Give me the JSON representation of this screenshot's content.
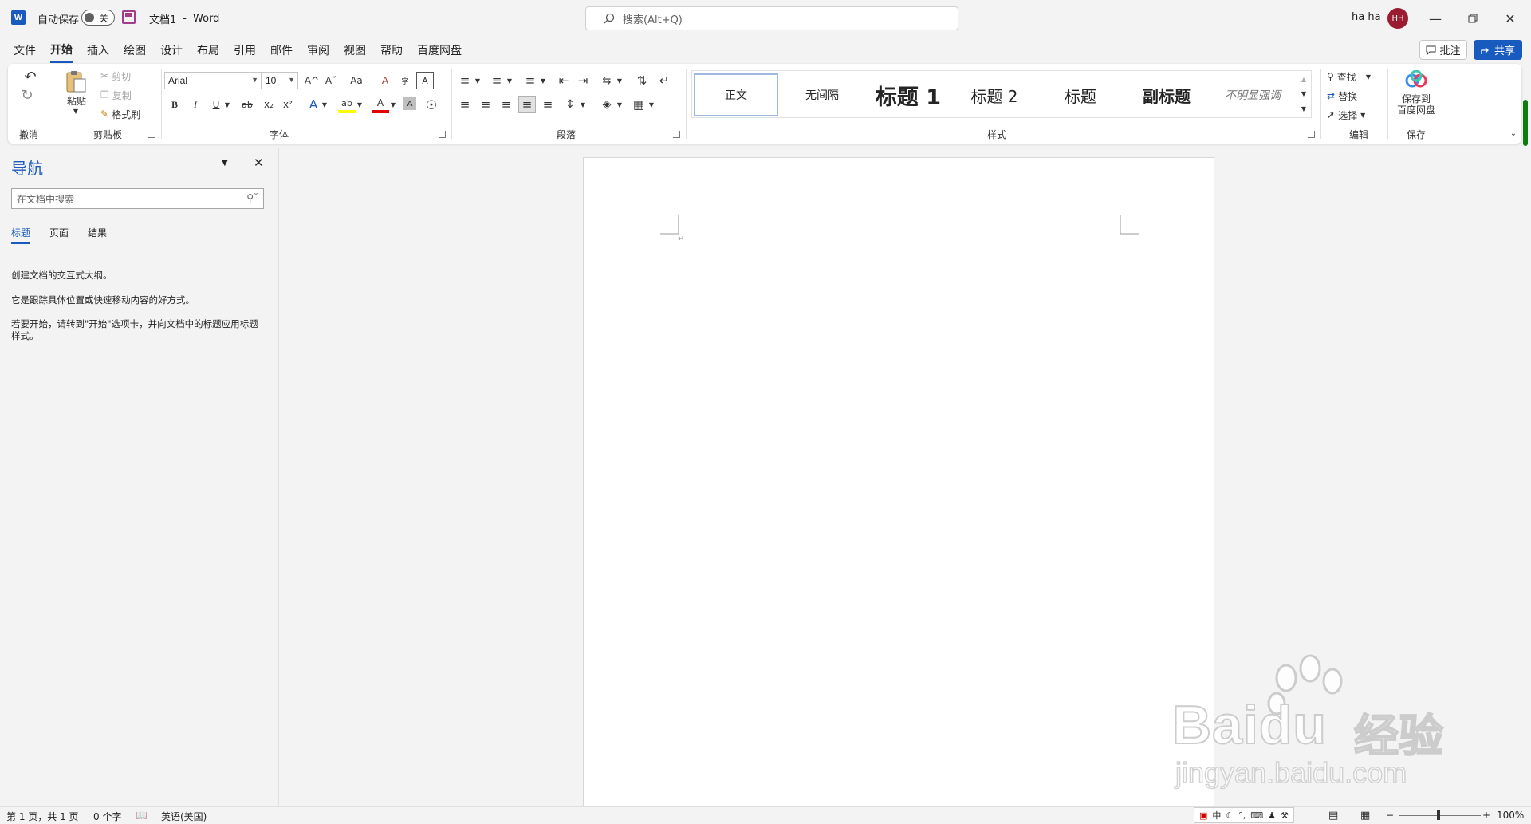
{
  "titlebar": {
    "app_icon": "W",
    "autosave_label": "自动保存",
    "autosave_state": "关",
    "doc_name": "文档1",
    "separator": "-",
    "app_name": "Word",
    "search_placeholder": "搜索(Alt+Q)",
    "user_name": "ha ha",
    "user_initials": "HH"
  },
  "menu": {
    "tabs": [
      "文件",
      "开始",
      "插入",
      "绘图",
      "设计",
      "布局",
      "引用",
      "邮件",
      "审阅",
      "视图",
      "帮助",
      "百度网盘"
    ],
    "active": "开始",
    "comment_label": "批注",
    "share_label": "共享"
  },
  "ribbon": {
    "undo_group": "撤消",
    "clipboard": {
      "paste": "粘贴",
      "cut": "剪切",
      "copy": "复制",
      "format_painter": "格式刷",
      "group": "剪贴板"
    },
    "font": {
      "name": "Arial",
      "size": "10",
      "group": "字体",
      "bold": "B",
      "italic": "I",
      "underline": "U",
      "strike": "ab",
      "sub": "x₂",
      "sup": "x²",
      "grow": "A^",
      "shrink": "Aˇ",
      "case": "Aa",
      "clear": "A",
      "effects": "A",
      "highlight": "ab",
      "color": "A",
      "shade": "A",
      "enclose": "字"
    },
    "paragraph": {
      "group": "段落"
    },
    "styles": {
      "group": "样式",
      "items": [
        "正文",
        "无间隔",
        "标题 1",
        "标题 2",
        "标题",
        "副标题",
        "不明显强调"
      ]
    },
    "editing": {
      "find": "查找",
      "replace": "替换",
      "select": "选择",
      "group": "编辑"
    },
    "save": {
      "line1": "保存到",
      "line2": "百度网盘",
      "group": "保存"
    }
  },
  "nav": {
    "title": "导航",
    "search_placeholder": "在文档中搜索",
    "tabs": [
      "标题",
      "页面",
      "结果"
    ],
    "active_tab": "标题",
    "msg1": "创建文档的交互式大纲。",
    "msg2": "它是跟踪具体位置或快速移动内容的好方式。",
    "msg3": "若要开始，请转到\"开始\"选项卡，并向文档中的标题应用标题样式。"
  },
  "status": {
    "page": "第 1 页，共 1 页",
    "words": "0 个字",
    "language": "英语(美国)",
    "ime_lang": "中",
    "zoom": "100%"
  },
  "watermark": {
    "main": "Bai",
    "du": "du",
    "cn": "经验",
    "sub": "jingyan.baidu.com"
  },
  "colors": {
    "accent": "#185abd",
    "avatar": "#9b1b30",
    "scrollbar": "#107c10"
  }
}
